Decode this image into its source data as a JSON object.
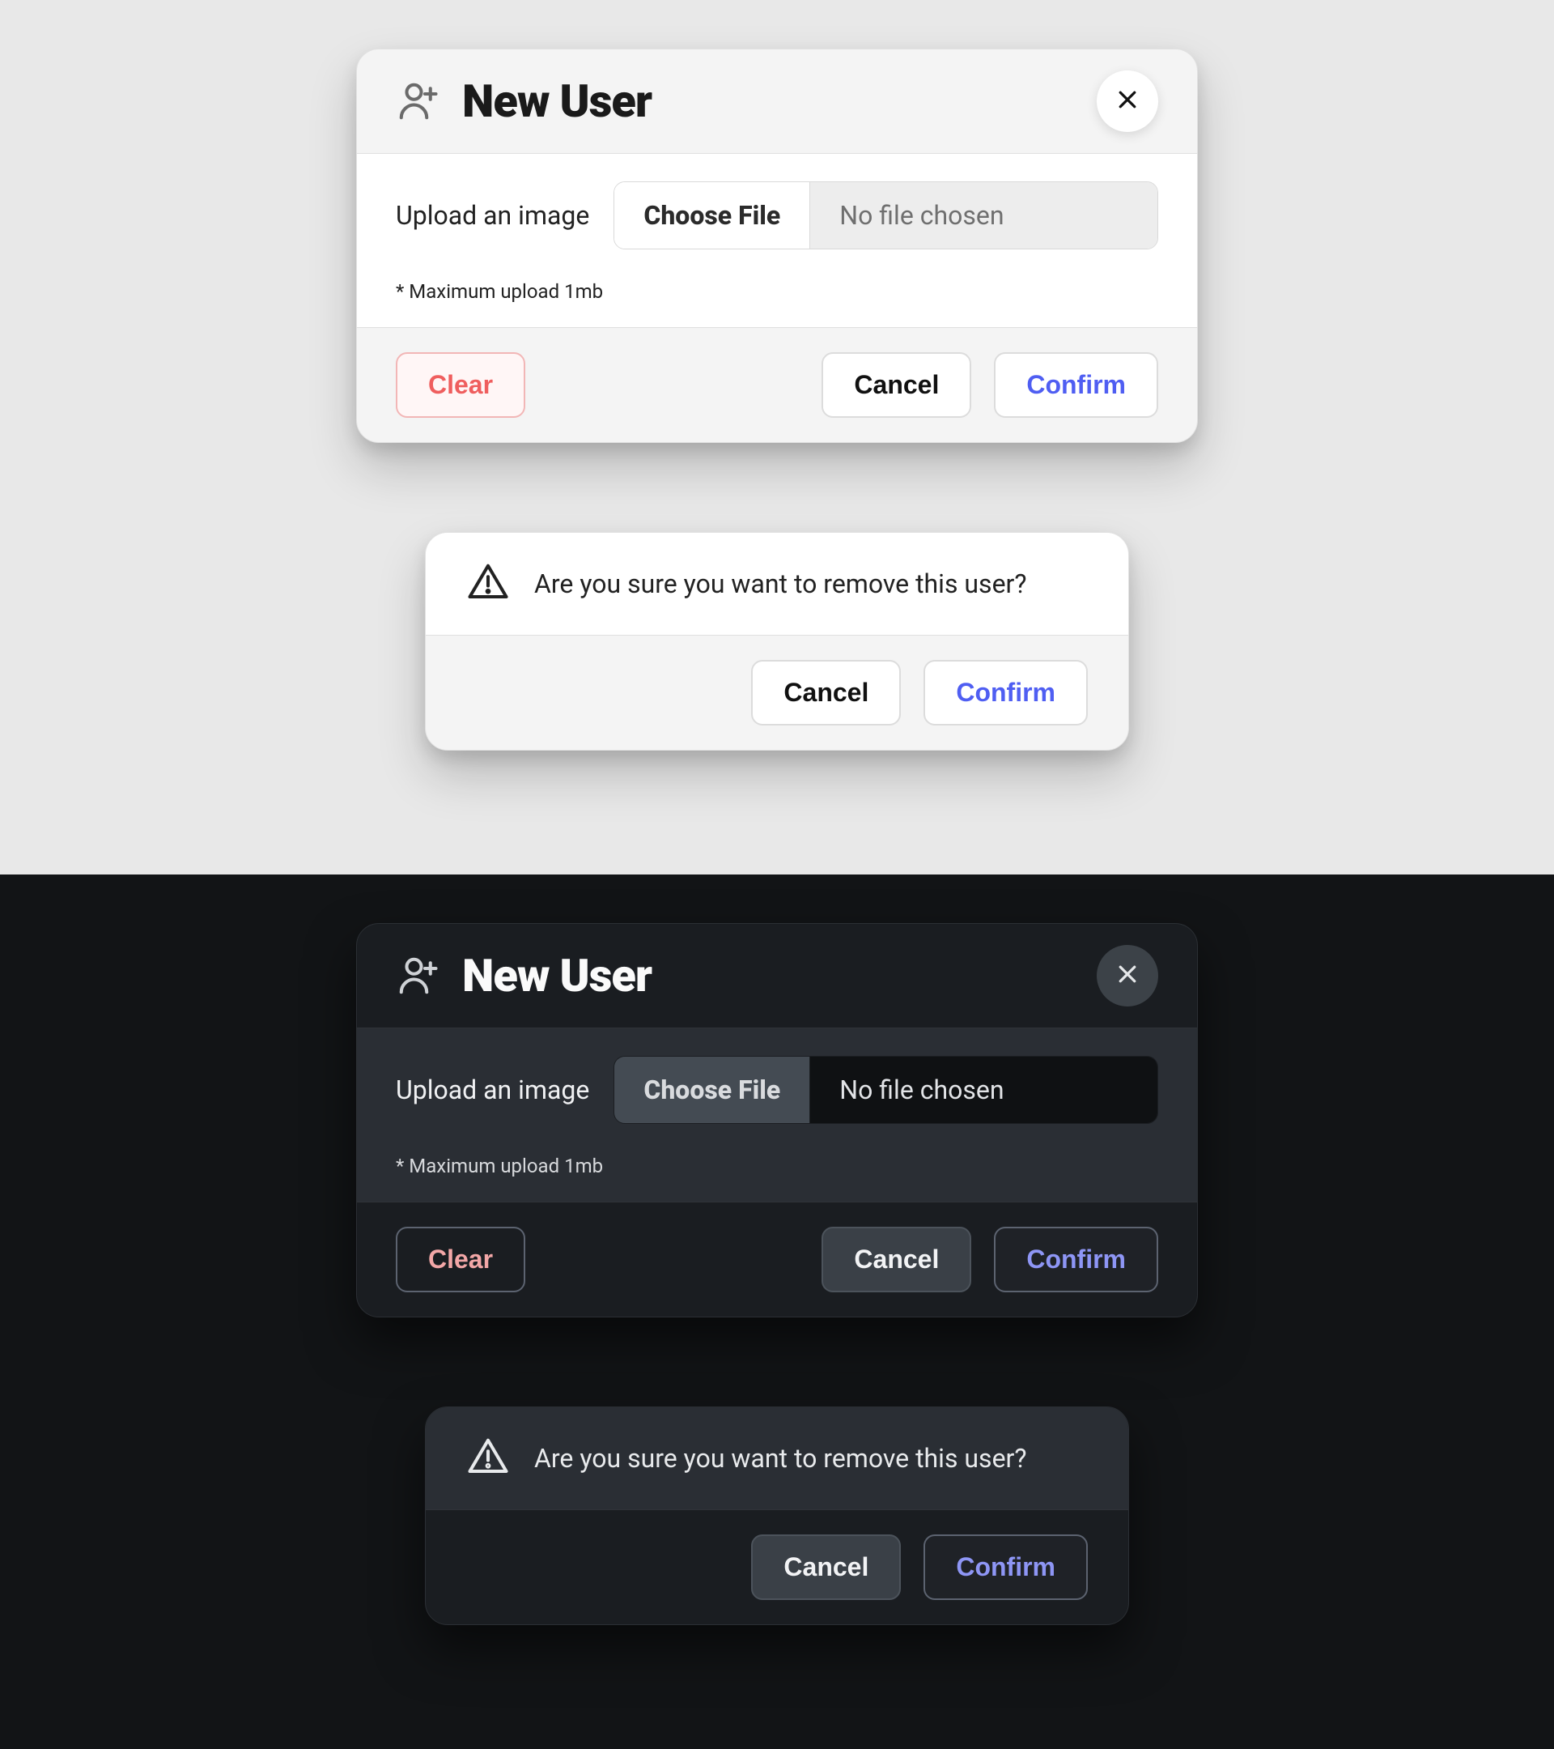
{
  "newUser": {
    "title": "New User",
    "uploadLabel": "Upload an image",
    "chooseFile": "Choose File",
    "noFile": "No file chosen",
    "hint": "* Maximum upload 1mb",
    "clear": "Clear",
    "cancel": "Cancel",
    "confirm": "Confirm"
  },
  "removeUser": {
    "message": "Are you sure you want to remove this user?",
    "cancel": "Cancel",
    "confirm": "Confirm"
  },
  "colors": {
    "lightBg": "#e8e8e8",
    "darkBg": "#121416",
    "accent": "#4f5ef2",
    "accentDark": "#8e96f5",
    "danger": "#ef5e5e"
  }
}
